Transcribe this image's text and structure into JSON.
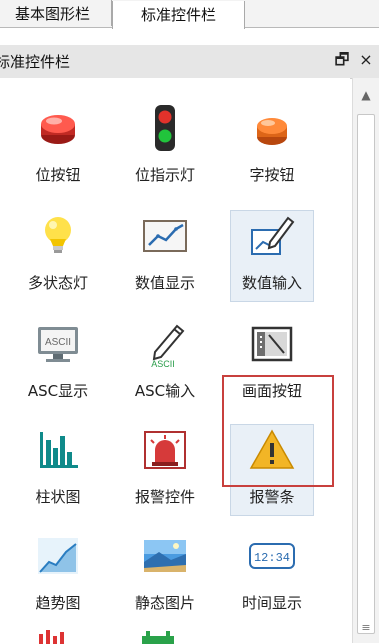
{
  "tabs": [
    {
      "label": "基本图形栏"
    },
    {
      "label": "标准控件栏"
    }
  ],
  "panel": {
    "title": "标准控件栏",
    "pin_icon": "pin-icon",
    "close_icon": "close-icon",
    "pin_glyph": "🗗",
    "close_glyph": "×"
  },
  "items": [
    {
      "label": "位按钮"
    },
    {
      "label": "位指示灯"
    },
    {
      "label": "字按钮"
    },
    {
      "label": "多状态灯"
    },
    {
      "label": "数值显示"
    },
    {
      "label": "数值输入"
    },
    {
      "label": "ASC显示"
    },
    {
      "label": "ASC输入"
    },
    {
      "label": "画面按钮"
    },
    {
      "label": "柱状图"
    },
    {
      "label": "报警控件"
    },
    {
      "label": "报警条"
    },
    {
      "label": "趋势图"
    },
    {
      "label": "静态图片"
    },
    {
      "label": "时间显示"
    }
  ],
  "icon_text": {
    "ascii": "ASCII",
    "time": "12:34"
  },
  "highlight": {
    "item": "画面按钮",
    "color": "#c8403d"
  }
}
